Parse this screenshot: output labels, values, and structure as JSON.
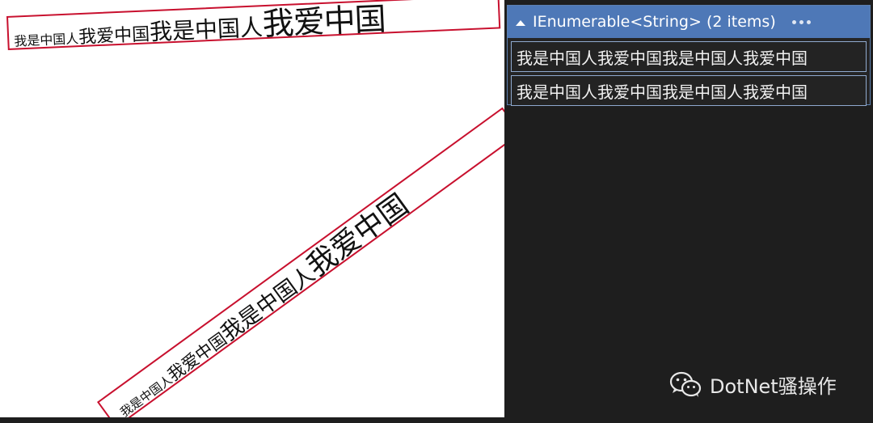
{
  "canvas": {
    "box1": {
      "segments": [
        "我是中国人",
        "我爱中国",
        "我是中国人",
        "我爱中国"
      ]
    },
    "box2": {
      "segments": [
        "我是中国人",
        "我爱中国",
        "我是中国人",
        "我爱中国"
      ]
    }
  },
  "debugger": {
    "title": "IEnumerable<String> (2 items)",
    "more_icon": "ellipsis-icon",
    "items": [
      "我是中国人我爱中国我是中国人我爱中国",
      "我是中国人我爱中国我是中国人我爱中国"
    ]
  },
  "watermark": {
    "icon": "wechat-icon",
    "text": "DotNet骚操作"
  },
  "colors": {
    "box_border": "#c8102e",
    "header_bg": "#4e78b7",
    "row_border": "#8fa9cf",
    "background": "#1e1e1e"
  }
}
